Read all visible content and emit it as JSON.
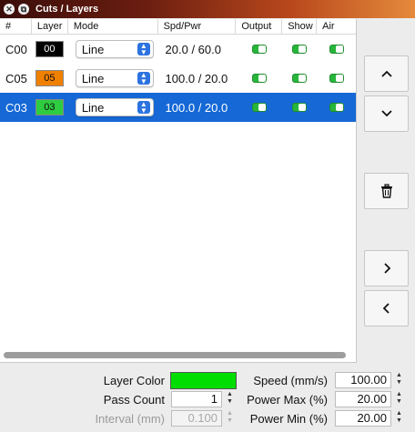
{
  "window": {
    "title": "Cuts / Layers"
  },
  "table": {
    "headers": {
      "num": "#",
      "layer": "Layer",
      "mode": "Mode",
      "spd": "Spd/Pwr",
      "output": "Output",
      "show": "Show",
      "air": "Air"
    },
    "rows": [
      {
        "num": "C00",
        "layer": "00",
        "layer_color": "#000000",
        "layer_text_color": "#ffffff",
        "mode": "Line",
        "spd": "20.0 / 60.0",
        "output": true,
        "show": true,
        "air": true,
        "selected": false
      },
      {
        "num": "C05",
        "layer": "05",
        "layer_color": "#f08000",
        "layer_text_color": "#111111",
        "mode": "Line",
        "spd": "100.0 / 20.0",
        "output": true,
        "show": true,
        "air": true,
        "selected": false
      },
      {
        "num": "C03",
        "layer": "03",
        "layer_color": "#2ecc40",
        "layer_text_color": "#111111",
        "mode": "Line",
        "spd": "100.0 / 20.0",
        "output": true,
        "show": true,
        "air": true,
        "selected": true
      }
    ]
  },
  "side_buttons": {
    "up": "^",
    "down": "v",
    "delete": "trash-icon",
    "right": ">",
    "left": "<"
  },
  "settings": {
    "layer_color_label": "Layer Color",
    "layer_color_value": "#00dd00",
    "pass_count_label": "Pass Count",
    "pass_count_value": "1",
    "interval_label": "Interval (mm)",
    "interval_value": "0.100",
    "speed_label": "Speed (mm/s)",
    "speed_value": "100.00",
    "power_max_label": "Power Max (%)",
    "power_max_value": "20.00",
    "power_min_label": "Power Min (%)",
    "power_min_value": "20.00"
  },
  "colors": {
    "accent": "#1568d6",
    "toggle_on": "#27b63b"
  }
}
